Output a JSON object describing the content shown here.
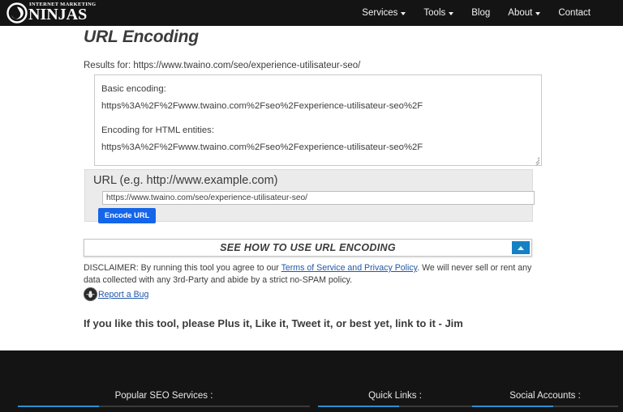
{
  "header": {
    "logo": {
      "superscript": "INTERNET MARKETING",
      "name": "NINJAS",
      "icon": "ninja-swirl-icon"
    },
    "nav": [
      {
        "label": "Services",
        "has_dropdown": true
      },
      {
        "label": "Tools",
        "has_dropdown": true
      },
      {
        "label": "Blog",
        "has_dropdown": false
      },
      {
        "label": "About",
        "has_dropdown": true
      },
      {
        "label": "Contact",
        "has_dropdown": false
      }
    ]
  },
  "main": {
    "title": "URL Encoding",
    "results_for": "Results for: https://www.twaino.com/seo/experience-utilisateur-seo/",
    "result_box": {
      "basic_label": "Basic encoding:",
      "basic_value": "https%3A%2F%2Fwww.twaino.com%2Fseo%2Fexperience-utilisateur-seo%2F",
      "html_label": "Encoding for HTML entities:",
      "html_value": "https%3A%2F%2Fwww.twaino.com%2Fseo%2Fexperience-utilisateur-seo%2F"
    },
    "url_form": {
      "label": "URL (e.g. http://www.example.com)",
      "input_value": "https://www.twaino.com/seo/experience-utilisateur-seo/",
      "input_placeholder": "URL (e.g. http://www.example.com)",
      "submit_label": "Encode URL"
    },
    "howto": {
      "label": "SEE HOW TO USE URL ENCODING",
      "toggle_icon": "chevron-up-icon"
    },
    "disclaimer": {
      "part1": "DISCLAIMER: By running this tool you agree to our ",
      "link": "Terms of Service and Privacy Policy",
      "part2": ". We will never sell or rent any data collected with any 3rd-Party and abide by a strict no-SPAM policy."
    },
    "report_bug": {
      "label": "Report a Bug",
      "icon": "bug-icon"
    },
    "tool_note": "If you like this tool, please Plus it, Like it, Tweet it, or best yet, link to it - Jim"
  },
  "footer": {
    "columns": [
      {
        "title": "Popular SEO Services :"
      },
      {
        "title": "Quick Links :"
      },
      {
        "title": "Social Accounts :"
      }
    ]
  },
  "colors": {
    "header_bg": "#141414",
    "accent_blue": "#1565e8",
    "toggle_blue": "#1580c4",
    "footer_rule_blue": "#2b8fd0",
    "link_blue": "#2257a8",
    "panel_gray": "#ebebeb"
  }
}
